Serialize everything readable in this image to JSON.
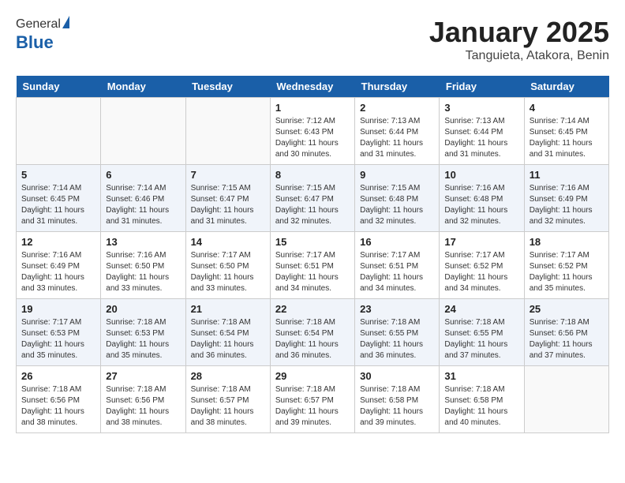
{
  "header": {
    "logo_general": "General",
    "logo_blue": "Blue",
    "title": "January 2025",
    "subtitle": "Tanguieta, Atakora, Benin"
  },
  "days_of_week": [
    "Sunday",
    "Monday",
    "Tuesday",
    "Wednesday",
    "Thursday",
    "Friday",
    "Saturday"
  ],
  "weeks": [
    [
      {
        "day": "",
        "sunrise": "",
        "sunset": "",
        "daylight": ""
      },
      {
        "day": "",
        "sunrise": "",
        "sunset": "",
        "daylight": ""
      },
      {
        "day": "",
        "sunrise": "",
        "sunset": "",
        "daylight": ""
      },
      {
        "day": "1",
        "sunrise": "Sunrise: 7:12 AM",
        "sunset": "Sunset: 6:43 PM",
        "daylight": "Daylight: 11 hours and 30 minutes."
      },
      {
        "day": "2",
        "sunrise": "Sunrise: 7:13 AM",
        "sunset": "Sunset: 6:44 PM",
        "daylight": "Daylight: 11 hours and 31 minutes."
      },
      {
        "day": "3",
        "sunrise": "Sunrise: 7:13 AM",
        "sunset": "Sunset: 6:44 PM",
        "daylight": "Daylight: 11 hours and 31 minutes."
      },
      {
        "day": "4",
        "sunrise": "Sunrise: 7:14 AM",
        "sunset": "Sunset: 6:45 PM",
        "daylight": "Daylight: 11 hours and 31 minutes."
      }
    ],
    [
      {
        "day": "5",
        "sunrise": "Sunrise: 7:14 AM",
        "sunset": "Sunset: 6:45 PM",
        "daylight": "Daylight: 11 hours and 31 minutes."
      },
      {
        "day": "6",
        "sunrise": "Sunrise: 7:14 AM",
        "sunset": "Sunset: 6:46 PM",
        "daylight": "Daylight: 11 hours and 31 minutes."
      },
      {
        "day": "7",
        "sunrise": "Sunrise: 7:15 AM",
        "sunset": "Sunset: 6:47 PM",
        "daylight": "Daylight: 11 hours and 31 minutes."
      },
      {
        "day": "8",
        "sunrise": "Sunrise: 7:15 AM",
        "sunset": "Sunset: 6:47 PM",
        "daylight": "Daylight: 11 hours and 32 minutes."
      },
      {
        "day": "9",
        "sunrise": "Sunrise: 7:15 AM",
        "sunset": "Sunset: 6:48 PM",
        "daylight": "Daylight: 11 hours and 32 minutes."
      },
      {
        "day": "10",
        "sunrise": "Sunrise: 7:16 AM",
        "sunset": "Sunset: 6:48 PM",
        "daylight": "Daylight: 11 hours and 32 minutes."
      },
      {
        "day": "11",
        "sunrise": "Sunrise: 7:16 AM",
        "sunset": "Sunset: 6:49 PM",
        "daylight": "Daylight: 11 hours and 32 minutes."
      }
    ],
    [
      {
        "day": "12",
        "sunrise": "Sunrise: 7:16 AM",
        "sunset": "Sunset: 6:49 PM",
        "daylight": "Daylight: 11 hours and 33 minutes."
      },
      {
        "day": "13",
        "sunrise": "Sunrise: 7:16 AM",
        "sunset": "Sunset: 6:50 PM",
        "daylight": "Daylight: 11 hours and 33 minutes."
      },
      {
        "day": "14",
        "sunrise": "Sunrise: 7:17 AM",
        "sunset": "Sunset: 6:50 PM",
        "daylight": "Daylight: 11 hours and 33 minutes."
      },
      {
        "day": "15",
        "sunrise": "Sunrise: 7:17 AM",
        "sunset": "Sunset: 6:51 PM",
        "daylight": "Daylight: 11 hours and 34 minutes."
      },
      {
        "day": "16",
        "sunrise": "Sunrise: 7:17 AM",
        "sunset": "Sunset: 6:51 PM",
        "daylight": "Daylight: 11 hours and 34 minutes."
      },
      {
        "day": "17",
        "sunrise": "Sunrise: 7:17 AM",
        "sunset": "Sunset: 6:52 PM",
        "daylight": "Daylight: 11 hours and 34 minutes."
      },
      {
        "day": "18",
        "sunrise": "Sunrise: 7:17 AM",
        "sunset": "Sunset: 6:52 PM",
        "daylight": "Daylight: 11 hours and 35 minutes."
      }
    ],
    [
      {
        "day": "19",
        "sunrise": "Sunrise: 7:17 AM",
        "sunset": "Sunset: 6:53 PM",
        "daylight": "Daylight: 11 hours and 35 minutes."
      },
      {
        "day": "20",
        "sunrise": "Sunrise: 7:18 AM",
        "sunset": "Sunset: 6:53 PM",
        "daylight": "Daylight: 11 hours and 35 minutes."
      },
      {
        "day": "21",
        "sunrise": "Sunrise: 7:18 AM",
        "sunset": "Sunset: 6:54 PM",
        "daylight": "Daylight: 11 hours and 36 minutes."
      },
      {
        "day": "22",
        "sunrise": "Sunrise: 7:18 AM",
        "sunset": "Sunset: 6:54 PM",
        "daylight": "Daylight: 11 hours and 36 minutes."
      },
      {
        "day": "23",
        "sunrise": "Sunrise: 7:18 AM",
        "sunset": "Sunset: 6:55 PM",
        "daylight": "Daylight: 11 hours and 36 minutes."
      },
      {
        "day": "24",
        "sunrise": "Sunrise: 7:18 AM",
        "sunset": "Sunset: 6:55 PM",
        "daylight": "Daylight: 11 hours and 37 minutes."
      },
      {
        "day": "25",
        "sunrise": "Sunrise: 7:18 AM",
        "sunset": "Sunset: 6:56 PM",
        "daylight": "Daylight: 11 hours and 37 minutes."
      }
    ],
    [
      {
        "day": "26",
        "sunrise": "Sunrise: 7:18 AM",
        "sunset": "Sunset: 6:56 PM",
        "daylight": "Daylight: 11 hours and 38 minutes."
      },
      {
        "day": "27",
        "sunrise": "Sunrise: 7:18 AM",
        "sunset": "Sunset: 6:56 PM",
        "daylight": "Daylight: 11 hours and 38 minutes."
      },
      {
        "day": "28",
        "sunrise": "Sunrise: 7:18 AM",
        "sunset": "Sunset: 6:57 PM",
        "daylight": "Daylight: 11 hours and 38 minutes."
      },
      {
        "day": "29",
        "sunrise": "Sunrise: 7:18 AM",
        "sunset": "Sunset: 6:57 PM",
        "daylight": "Daylight: 11 hours and 39 minutes."
      },
      {
        "day": "30",
        "sunrise": "Sunrise: 7:18 AM",
        "sunset": "Sunset: 6:58 PM",
        "daylight": "Daylight: 11 hours and 39 minutes."
      },
      {
        "day": "31",
        "sunrise": "Sunrise: 7:18 AM",
        "sunset": "Sunset: 6:58 PM",
        "daylight": "Daylight: 11 hours and 40 minutes."
      },
      {
        "day": "",
        "sunrise": "",
        "sunset": "",
        "daylight": ""
      }
    ]
  ]
}
